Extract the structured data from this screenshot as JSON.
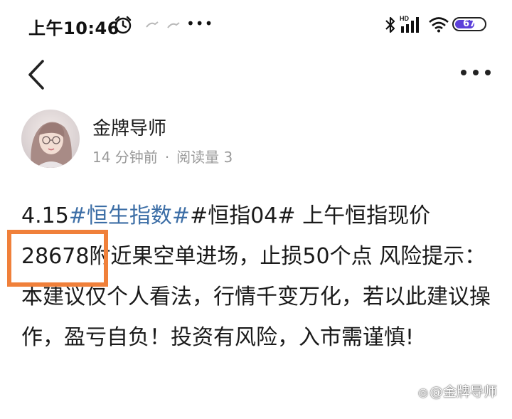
{
  "status_bar": {
    "time": "上午10:46",
    "notification_overflow": "•••",
    "battery_percent": "67",
    "battery_level": 0.67,
    "battery_color": "#5b3fd9",
    "signal_label": "HD",
    "icons": [
      "alarm-icon",
      "notification-icon",
      "notification-icon",
      "bluetooth-icon",
      "hd-signal-icon",
      "wifi-icon",
      "battery-icon"
    ]
  },
  "nav": {
    "back_icon": "chevron-left-icon",
    "more_icon": "more-dots-icon"
  },
  "post": {
    "author": {
      "name": "金牌导师",
      "avatar": "avatar-photo"
    },
    "meta": {
      "time_ago": "14 分钟前",
      "separator": "·",
      "reads": "阅读量 3"
    },
    "content": {
      "prefix": "4.15",
      "hashtag1": "#恒生指数#",
      "hashtag2": "#恒指04#",
      "text": " 上午恒指现价28678附近果空单进场，止损50个点 风险提示：本建议仅个人看法，行情千变万化，若以此建议操作，盈亏自负！投资有风险，入市需谨慎!"
    }
  },
  "annotation": {
    "highlight_color": "#f0803a"
  },
  "watermark": {
    "icon": "weibo-icon",
    "text": "@金牌导师"
  },
  "colors": {
    "hashtag": "#3c6ea6",
    "meta_text": "#9a9a9a",
    "body_text": "#1a1a1a"
  }
}
